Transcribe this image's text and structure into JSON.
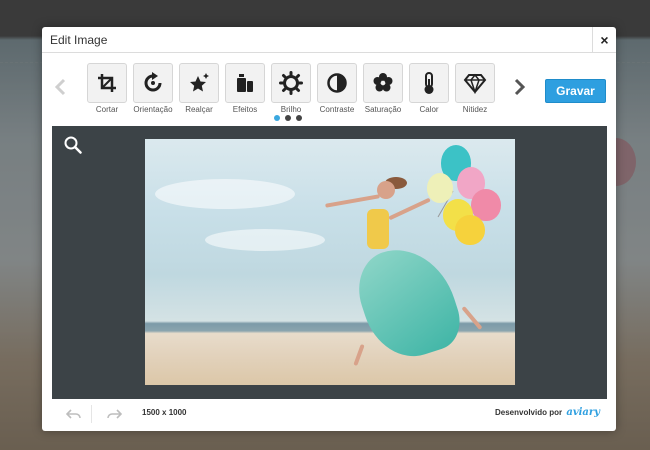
{
  "modal": {
    "title": "Edit Image",
    "close_label": "×"
  },
  "toolbar": {
    "tools": [
      {
        "label": "Cortar",
        "icon": "crop-icon"
      },
      {
        "label": "Orientação",
        "icon": "rotate-icon"
      },
      {
        "label": "Realçar",
        "icon": "enhance-icon"
      },
      {
        "label": "Efeitos",
        "icon": "effects-icon"
      },
      {
        "label": "Brilho",
        "icon": "brightness-icon"
      },
      {
        "label": "Contraste",
        "icon": "contrast-icon"
      },
      {
        "label": "Saturação",
        "icon": "saturation-icon"
      },
      {
        "label": "Calor",
        "icon": "thermometer-icon"
      },
      {
        "label": "Nitidez",
        "icon": "diamond-icon"
      }
    ],
    "pages": 3,
    "active_page": 1,
    "save_label": "Gravar"
  },
  "footer": {
    "dimensions": "1500 x 1000",
    "powered_by": "Desenvolvido por",
    "brand": "aviary"
  },
  "colors": {
    "accent": "#2e9fe0",
    "canvas_bg": "#3c4347",
    "dot_active": "#3aa8e0"
  }
}
